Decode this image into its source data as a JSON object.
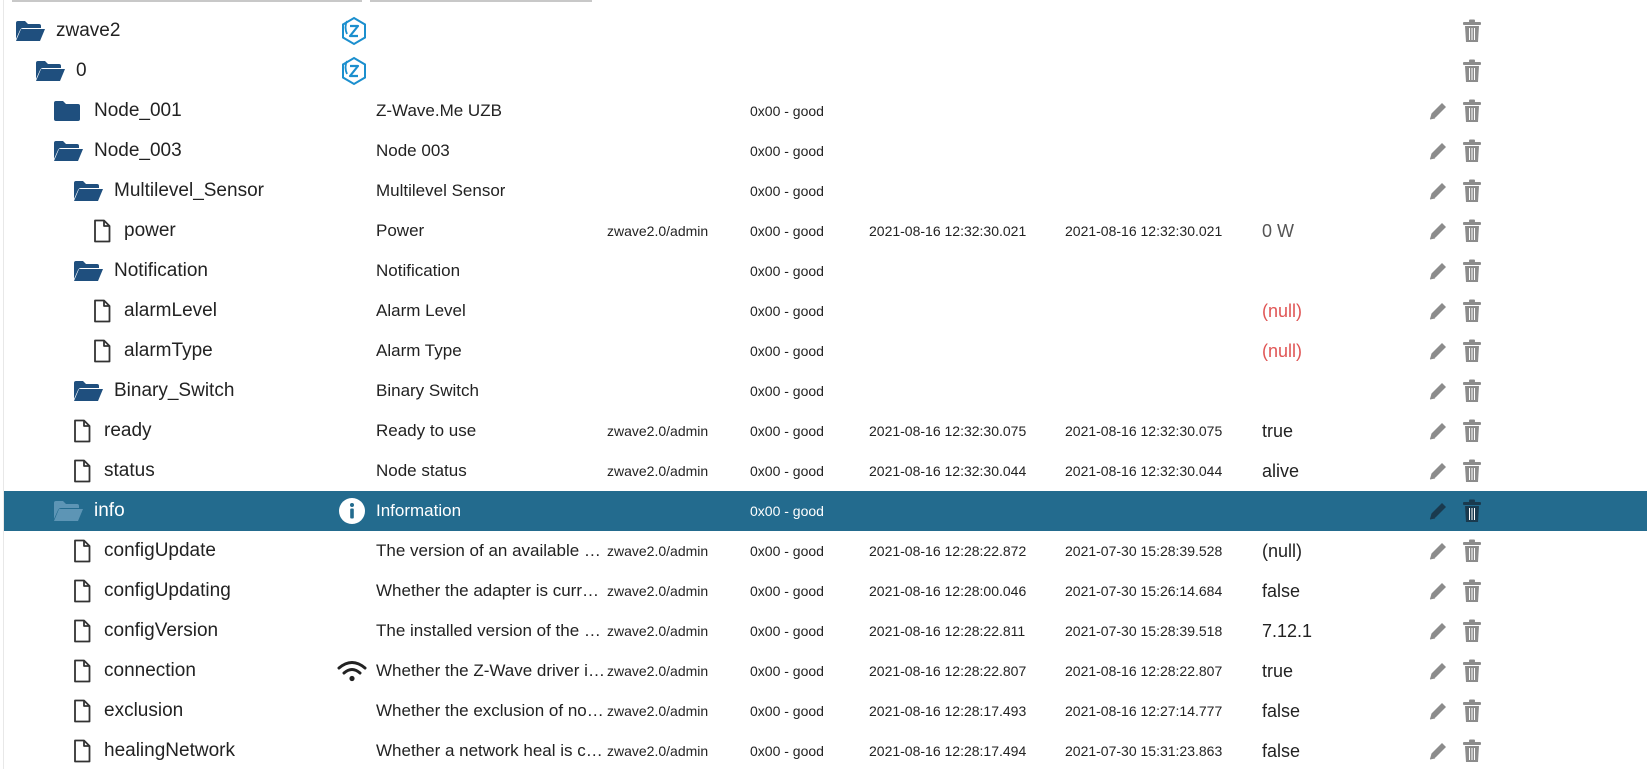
{
  "colors": {
    "folder": "#1f4f7e",
    "selected_row": "#236b8e",
    "null_value": "#e05555",
    "action_icon": "#8c8c8c",
    "zwave_logo": "#1b8fce"
  },
  "rows": [
    {
      "name": "zwave2",
      "level": 0,
      "icon": "folder-open-icon",
      "col_icon": "zwave-logo-icon",
      "role_name": "",
      "user": "",
      "quality": "",
      "ts": "",
      "lc": "",
      "value": "",
      "edit": false
    },
    {
      "name": "0",
      "level": 1,
      "icon": "folder-open-icon",
      "col_icon": "zwave-logo-icon",
      "role_name": "",
      "user": "",
      "quality": "",
      "ts": "",
      "lc": "",
      "value": "",
      "edit": false
    },
    {
      "name": "Node_001",
      "level": 2,
      "icon": "folder-closed-icon",
      "col_icon": "",
      "role_name": "Z-Wave.Me UZB",
      "user": "",
      "quality": "0x00 - good",
      "ts": "",
      "lc": "",
      "value": "",
      "edit": true
    },
    {
      "name": "Node_003",
      "level": 2,
      "icon": "folder-open-icon",
      "col_icon": "",
      "role_name": "Node 003",
      "user": "",
      "quality": "0x00 - good",
      "ts": "",
      "lc": "",
      "value": "",
      "edit": true
    },
    {
      "name": "Multilevel_Sensor",
      "level": 3,
      "icon": "folder-open-icon",
      "col_icon": "",
      "role_name": "Multilevel Sensor",
      "user": "",
      "quality": "0x00 - good",
      "ts": "",
      "lc": "",
      "value": "",
      "edit": true
    },
    {
      "name": "power",
      "level": 4,
      "icon": "file-icon",
      "col_icon": "",
      "role_name": "Power",
      "user": "zwave2.0/admin",
      "quality": "0x00 - good",
      "ts": "2021-08-16 12:32:30.021",
      "lc": "2021-08-16 12:32:30.021",
      "value": "0 W",
      "value_style": "unit",
      "edit": true
    },
    {
      "name": "Notification",
      "level": 3,
      "icon": "folder-open-icon",
      "col_icon": "",
      "role_name": "Notification",
      "user": "",
      "quality": "0x00 - good",
      "ts": "",
      "lc": "",
      "value": "",
      "edit": true
    },
    {
      "name": "alarmLevel",
      "level": 4,
      "icon": "file-icon",
      "col_icon": "",
      "role_name": "Alarm Level",
      "user": "",
      "quality": "0x00 - good",
      "ts": "",
      "lc": "",
      "value": "(null)",
      "value_style": "null",
      "edit": true
    },
    {
      "name": "alarmType",
      "level": 4,
      "icon": "file-icon",
      "col_icon": "",
      "role_name": "Alarm Type",
      "user": "",
      "quality": "0x00 - good",
      "ts": "",
      "lc": "",
      "value": "(null)",
      "value_style": "null",
      "edit": true
    },
    {
      "name": "Binary_Switch",
      "level": 3,
      "icon": "folder-open-icon",
      "col_icon": "",
      "role_name": "Binary Switch",
      "user": "",
      "quality": "0x00 - good",
      "ts": "",
      "lc": "",
      "value": "",
      "edit": true
    },
    {
      "name": "ready",
      "level": 3,
      "icon": "file-icon",
      "col_icon": "",
      "role_name": "Ready to use",
      "user": "zwave2.0/admin",
      "quality": "0x00 - good",
      "ts": "2021-08-16 12:32:30.075",
      "lc": "2021-08-16 12:32:30.075",
      "value": "true",
      "edit": true
    },
    {
      "name": "status",
      "level": 3,
      "icon": "file-icon",
      "col_icon": "",
      "role_name": "Node status",
      "user": "zwave2.0/admin",
      "quality": "0x00 - good",
      "ts": "2021-08-16 12:32:30.044",
      "lc": "2021-08-16 12:32:30.044",
      "value": "alive",
      "edit": true
    },
    {
      "name": "info",
      "level": 2,
      "icon": "folder-open-icon",
      "col_icon": "info-icon",
      "role_name": "Information",
      "user": "",
      "quality": "0x00 - good",
      "ts": "",
      "lc": "",
      "value": "",
      "edit": true,
      "selected": true
    },
    {
      "name": "configUpdate",
      "level": 3,
      "icon": "file-icon",
      "col_icon": "",
      "role_name": "The version of an available update",
      "user": "zwave2.0/admin",
      "quality": "0x00 - good",
      "ts": "2021-08-16 12:28:22.872",
      "lc": "2021-07-30 15:28:39.528",
      "value": "(null)",
      "edit": true
    },
    {
      "name": "configUpdating",
      "level": 3,
      "icon": "file-icon",
      "col_icon": "",
      "role_name": "Whether the adapter is currently updating",
      "user": "zwave2.0/admin",
      "quality": "0x00 - good",
      "ts": "2021-08-16 12:28:00.046",
      "lc": "2021-07-30 15:26:14.684",
      "value": "false",
      "edit": true
    },
    {
      "name": "configVersion",
      "level": 3,
      "icon": "file-icon",
      "col_icon": "",
      "role_name": "The installed version of the Z-Wave config",
      "user": "zwave2.0/admin",
      "quality": "0x00 - good",
      "ts": "2021-08-16 12:28:22.811",
      "lc": "2021-07-30 15:28:39.518",
      "value": "7.12.1",
      "edit": true
    },
    {
      "name": "connection",
      "level": 3,
      "icon": "file-icon",
      "col_icon": "wifi-icon",
      "role_name": "Whether the Z-Wave driver is ready",
      "user": "zwave2.0/admin",
      "quality": "0x00 - good",
      "ts": "2021-08-16 12:28:22.807",
      "lc": "2021-08-16 12:28:22.807",
      "value": "true",
      "edit": true
    },
    {
      "name": "exclusion",
      "level": 3,
      "icon": "file-icon",
      "col_icon": "",
      "role_name": "Whether the exclusion of nodes is active",
      "user": "zwave2.0/admin",
      "quality": "0x00 - good",
      "ts": "2021-08-16 12:28:17.493",
      "lc": "2021-08-16 12:27:14.777",
      "value": "false",
      "edit": true
    },
    {
      "name": "healingNetwork",
      "level": 3,
      "icon": "file-icon",
      "col_icon": "",
      "role_name": "Whether a network heal is currently running",
      "user": "zwave2.0/admin",
      "quality": "0x00 - good",
      "ts": "2021-08-16 12:28:17.494",
      "lc": "2021-07-30 15:31:23.863",
      "value": "false",
      "edit": true
    }
  ]
}
